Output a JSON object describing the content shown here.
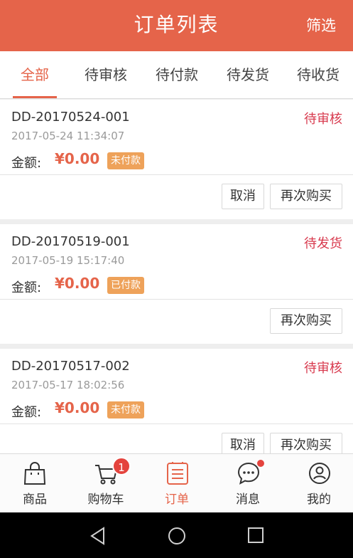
{
  "header": {
    "title": "订单列表",
    "filter_label": "筛选"
  },
  "tabs": [
    {
      "label": "全部",
      "active": true
    },
    {
      "label": "待审核"
    },
    {
      "label": "待付款"
    },
    {
      "label": "待发货"
    },
    {
      "label": "待收货"
    }
  ],
  "amount_label": "金额:",
  "orders": [
    {
      "number": "DD-20170524-001",
      "status": "待审核",
      "time": "2017-05-24 11:34:07",
      "amount": "¥0.00",
      "pay_status": "未付款",
      "cancel_label": "取消",
      "rebuy_label": "再次购买"
    },
    {
      "number": "DD-20170519-001",
      "status": "待发货",
      "time": "2017-05-19 15:17:40",
      "amount": "¥0.00",
      "pay_status": "已付款",
      "rebuy_label": "再次购买"
    },
    {
      "number": "DD-20170517-002",
      "status": "待审核",
      "time": "2017-05-17 18:02:56",
      "amount": "¥0.00",
      "pay_status": "未付款",
      "cancel_label": "取消",
      "rebuy_label": "再次购买"
    }
  ],
  "tabbar": {
    "items": [
      {
        "label": "商品",
        "icon": "shopping-bag-icon"
      },
      {
        "label": "购物车",
        "icon": "cart-icon",
        "badge": "1"
      },
      {
        "label": "订单",
        "icon": "order-list-icon",
        "active": true
      },
      {
        "label": "消息",
        "icon": "message-icon",
        "has_dot": true
      },
      {
        "label": "我的",
        "icon": "user-icon"
      }
    ]
  },
  "colors": {
    "brand": "#e5644a",
    "status_red": "#d83a4e",
    "badge_orange": "#eea25a"
  }
}
